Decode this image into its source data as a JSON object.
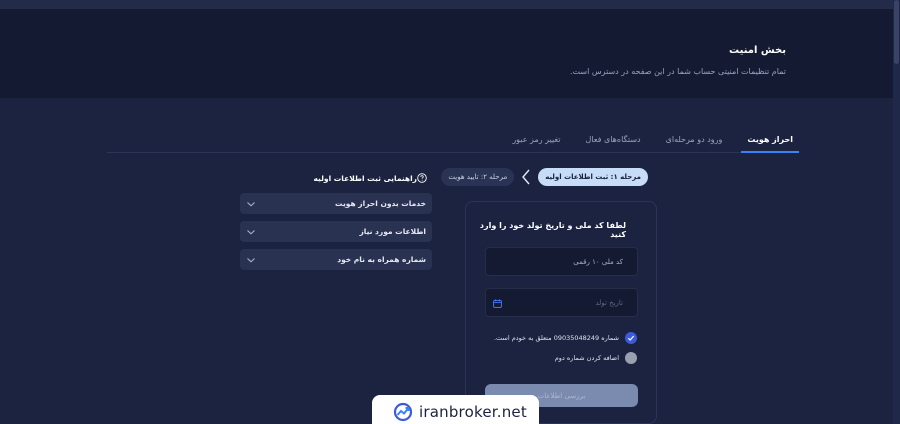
{
  "header": {
    "title": "بخش امنیت",
    "subtitle": "تمام تنظیمات امنیتی حساب شما در این صفحه در دسترس است."
  },
  "tabs": [
    {
      "label": "احراز هویت",
      "active": true
    },
    {
      "label": "ورود دو مرحله‌ای",
      "active": false
    },
    {
      "label": "دستگاه‌های فعال",
      "active": false
    },
    {
      "label": "تغییر رمز عبور",
      "active": false
    }
  ],
  "stepper": {
    "step1": "مرحله ۱: ثبت اطلاعات اولیه",
    "step2": "مرحله ۲: تایید هویت"
  },
  "guide": {
    "title": "راهنمایی ثبت اطلاعات اولیه",
    "items": [
      {
        "label": "خدمات بدون احراز هویت"
      },
      {
        "label": "اطلاعات مورد نیاز"
      },
      {
        "label": "شماره همراه به نام خود"
      }
    ]
  },
  "form": {
    "title": "لطفا کد ملی و تاریخ تولد خود را وارد کنید",
    "national_code_placeholder": "کد ملی ۱۰ رقمی",
    "birth_date_placeholder": "تاریخ تولد",
    "own_number_label": "شماره 09035048249 متعلق به خودم است.",
    "own_number_checked": true,
    "second_number_label": "اضافه کردن شماره دوم",
    "second_number_checked": false,
    "submit_label": "بررسی اطلاعات"
  },
  "watermark": {
    "text": "iranbroker.net"
  },
  "colors": {
    "background": "#1b2340",
    "header_bg": "#141a31",
    "accent": "#3b82f6",
    "step_active": "#c7dcf6",
    "checkbox_on": "#3b5bdb"
  },
  "icons": [
    "chevron-left-icon",
    "help-circle-icon",
    "chevron-down-icon",
    "calendar-icon",
    "check-icon",
    "iranbroker-logo-icon"
  ]
}
